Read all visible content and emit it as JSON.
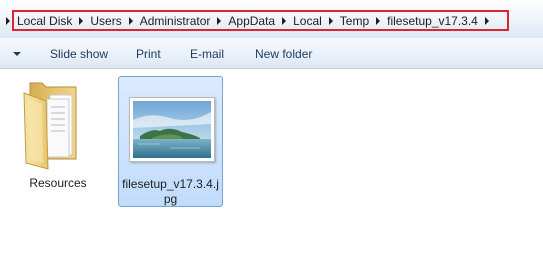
{
  "address_bar": {
    "breadcrumbs": [
      "Local Disk",
      "Users",
      "Administrator",
      "AppData",
      "Local",
      "Temp",
      "filesetup_v17.3.4"
    ]
  },
  "toolbar": {
    "slideshow_label": "Slide show",
    "print_label": "Print",
    "email_label": "E-mail",
    "new_folder_label": "New folder"
  },
  "files": [
    {
      "name": "Resources",
      "type": "folder",
      "icon": "folder-icon",
      "selected": false
    },
    {
      "name": "filesetup_v17.3.4.jpg",
      "type": "image",
      "icon": "image-thumbnail",
      "selected": true
    }
  ],
  "colors": {
    "highlight_border": "#dc2530",
    "selection_fill": "#cce4fc",
    "selection_border": "#7da2ce",
    "toolbar_text": "#1e3c64"
  }
}
